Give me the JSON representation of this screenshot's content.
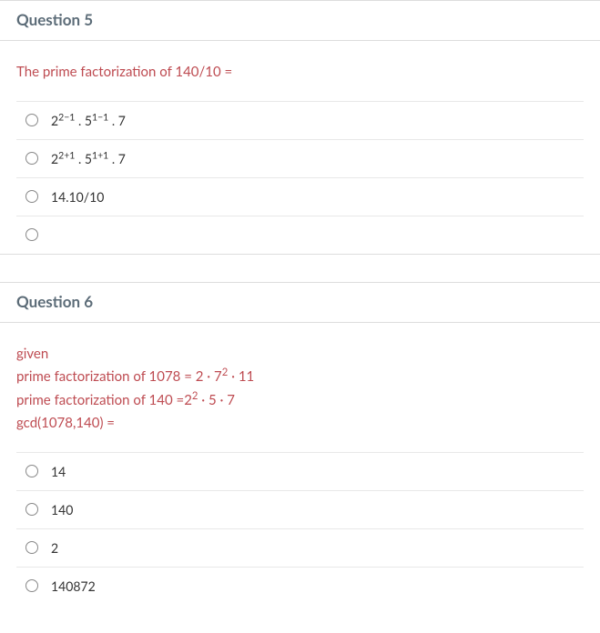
{
  "questions": [
    {
      "title": "Question 5",
      "prompt_lines": [
        "The prime factorization of 140/10 ="
      ],
      "options": [
        {
          "html": "2<sup>2−1</sup> . 5<sup>1−1</sup> . 7"
        },
        {
          "html": "2<sup>2+1</sup>  . 5<sup>1+1</sup>  . 7"
        },
        {
          "html": "14.10/10"
        },
        {
          "html": ""
        }
      ]
    },
    {
      "title": "Question 6",
      "prompt_lines": [
        "given",
        "prime factorization of 1078 = 2 · 7<sup>2</sup> · 11",
        "prime factorization of 140 =2<sup>2</sup> · 5 · 7",
        "gcd(1078,140) ="
      ],
      "options": [
        {
          "html": "14"
        },
        {
          "html": "140"
        },
        {
          "html": "2"
        },
        {
          "html": "140872"
        }
      ]
    }
  ]
}
